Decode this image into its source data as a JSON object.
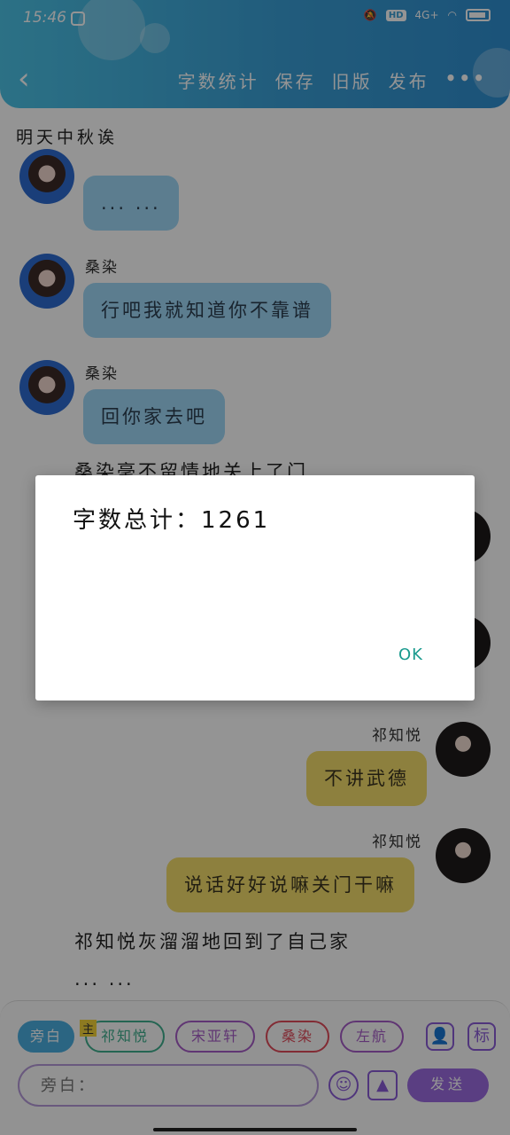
{
  "status_bar": {
    "time": "15:46",
    "hd": "HD",
    "network": "4G+"
  },
  "toolbar": {
    "word_count": "字数统计",
    "save": "保存",
    "old_version": "旧版",
    "publish": "发布",
    "more": "•••"
  },
  "chat": {
    "title": "明天中秋诶",
    "messages": [
      {
        "text": "... ..."
      },
      {
        "name": "桑染",
        "text": "行吧我就知道你不靠谱"
      },
      {
        "name": "桑染",
        "text": "回你家去吧"
      },
      {
        "text": "桑染毫不留情地关上了门"
      },
      {
        "name": "祁知悦",
        "text": "不讲武德"
      },
      {
        "name": "祁知悦",
        "text": "说话好好说嘛关门干嘛"
      },
      {
        "text": "祁知悦灰溜溜地回到了自己家"
      },
      {
        "text": "... ..."
      }
    ]
  },
  "input": {
    "chips": [
      "旁白",
      "祁知悦",
      "宋亚轩",
      "桑染",
      "左航"
    ],
    "badge": "主",
    "placeholder": "旁白：",
    "send": "发送",
    "icon_label": "标"
  },
  "dialog": {
    "message": "字数总计：1261",
    "ok": "OK"
  }
}
